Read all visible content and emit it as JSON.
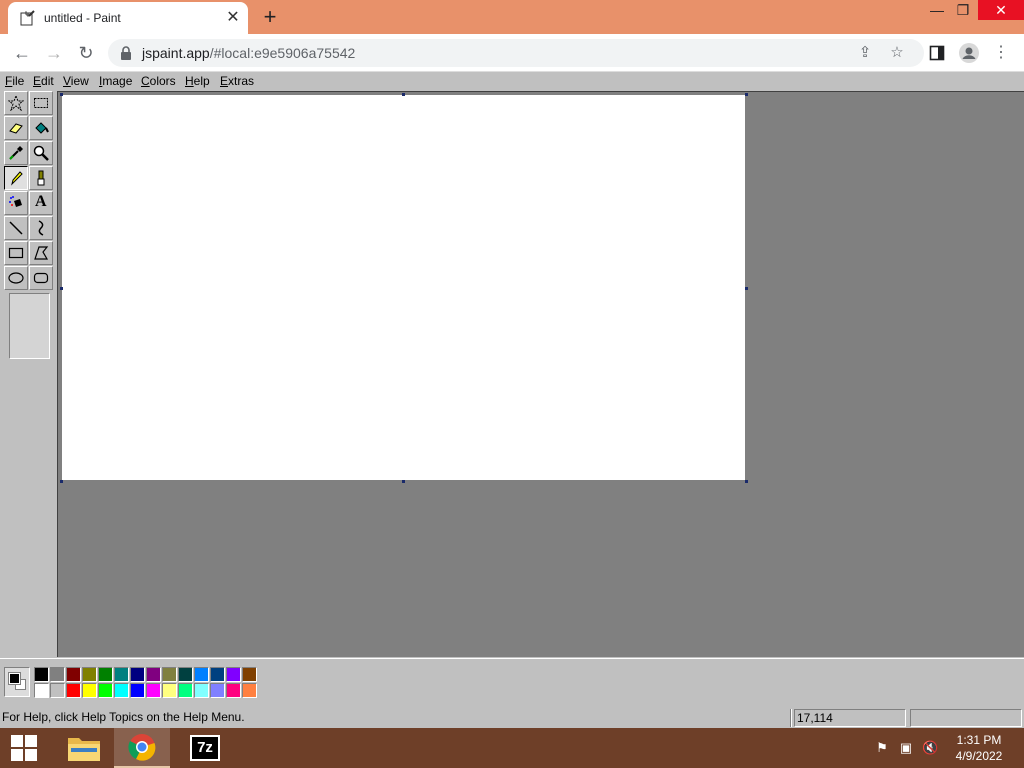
{
  "browser": {
    "tab_title": "untitled - Paint",
    "tab_close": "✕",
    "new_tab": "+",
    "url_host": "jspaint.app",
    "url_rest": "/#local:e9e5906a75542",
    "window_controls": {
      "minimize": "—",
      "restore": "❐",
      "close": "✕"
    }
  },
  "menu": {
    "items": [
      "File",
      "Edit",
      "View",
      "Image",
      "Colors",
      "Help",
      "Extras"
    ]
  },
  "tools": [
    {
      "name": "free-form-select",
      "icon": "star-select-icon"
    },
    {
      "name": "rect-select",
      "icon": "rect-select-icon"
    },
    {
      "name": "eraser",
      "icon": "eraser-icon"
    },
    {
      "name": "fill",
      "icon": "fill-bucket-icon"
    },
    {
      "name": "pick-color",
      "icon": "eyedropper-icon"
    },
    {
      "name": "magnifier",
      "icon": "magnifier-icon"
    },
    {
      "name": "pencil",
      "icon": "pencil-icon",
      "active": true
    },
    {
      "name": "brush",
      "icon": "brush-icon"
    },
    {
      "name": "airbrush",
      "icon": "airbrush-icon"
    },
    {
      "name": "text",
      "icon": "text-icon",
      "label": "A"
    },
    {
      "name": "line",
      "icon": "line-icon"
    },
    {
      "name": "curve",
      "icon": "curve-icon"
    },
    {
      "name": "rectangle",
      "icon": "rectangle-icon"
    },
    {
      "name": "polygon",
      "icon": "polygon-icon"
    },
    {
      "name": "ellipse",
      "icon": "ellipse-icon"
    },
    {
      "name": "rounded-rectangle",
      "icon": "rounded-rect-icon"
    }
  ],
  "palette": {
    "foreground": "#000000",
    "background": "#ffffff",
    "row1": [
      "#000000",
      "#808080",
      "#800000",
      "#808000",
      "#008000",
      "#008080",
      "#000080",
      "#800080",
      "#808040",
      "#004040",
      "#0080ff",
      "#004080",
      "#8000ff",
      "#804000"
    ],
    "row2": [
      "#ffffff",
      "#c0c0c0",
      "#ff0000",
      "#ffff00",
      "#00ff00",
      "#00ffff",
      "#0000ff",
      "#ff00ff",
      "#ffff80",
      "#00ff80",
      "#80ffff",
      "#8080ff",
      "#ff0080",
      "#ff8040"
    ]
  },
  "status": {
    "help_text": "For Help, click Help Topics on the Help Menu.",
    "position": "17,114",
    "size": ""
  },
  "taskbar": {
    "time": "1:31 PM",
    "date": "4/9/2022",
    "apps": [
      "file-explorer",
      "chrome",
      "7zip"
    ],
    "sevenzip_label": "7z"
  }
}
